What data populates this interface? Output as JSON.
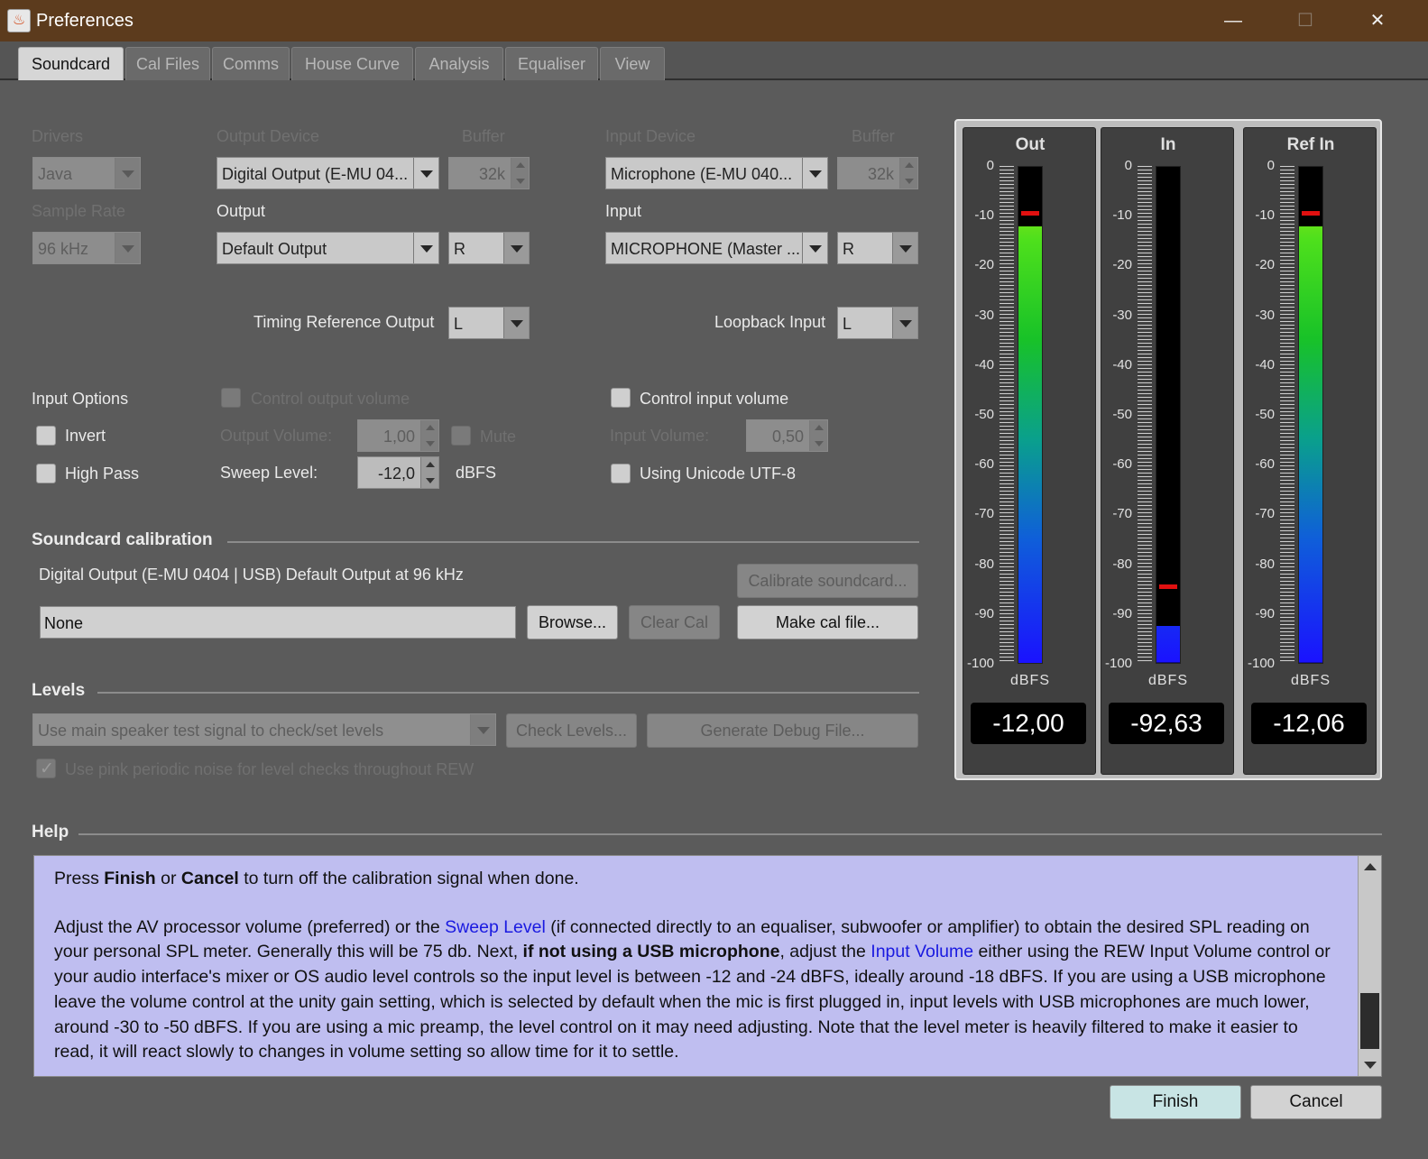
{
  "window": {
    "title": "Preferences"
  },
  "tabs": [
    "Soundcard",
    "Cal Files",
    "Comms",
    "House Curve",
    "Analysis",
    "Equaliser",
    "View"
  ],
  "drivers": {
    "label": "Drivers",
    "value": "Java"
  },
  "sample_rate": {
    "label": "Sample Rate",
    "value": "96 kHz"
  },
  "output_device": {
    "label": "Output Device",
    "value": "Digital Output (E-MU 04...",
    "buffer_label": "Buffer",
    "buffer": "32k"
  },
  "input_device": {
    "label": "Input Device",
    "value": "Microphone (E-MU 040...",
    "buffer_label": "Buffer",
    "buffer": "32k"
  },
  "output": {
    "label": "Output",
    "value": "Default Output",
    "channel": "R"
  },
  "input": {
    "label": "Input",
    "value": "MICROPHONE (Master ...",
    "channel": "R"
  },
  "timing_reference_output": {
    "label": "Timing Reference Output",
    "value": "L"
  },
  "loopback_input": {
    "label": "Loopback Input",
    "value": "L"
  },
  "input_options": {
    "label": "Input Options",
    "invert": "Invert",
    "high_pass": "High Pass"
  },
  "output_volume": {
    "control_label": "Control output volume",
    "label": "Output Volume:",
    "value": "1,00",
    "mute": "Mute"
  },
  "sweep": {
    "label": "Sweep Level:",
    "value": "-12,0",
    "unit": "dBFS"
  },
  "input_volume": {
    "control_label": "Control input volume",
    "label": "Input Volume:",
    "value": "0,50",
    "unicode": "Using Unicode UTF-8"
  },
  "calibration": {
    "title": "Soundcard calibration",
    "description": "Digital Output (E-MU 0404 | USB) Default Output at 96 kHz",
    "file": "None",
    "browse": "Browse...",
    "clear": "Clear Cal",
    "calibrate": "Calibrate soundcard...",
    "make": "Make cal file..."
  },
  "levels": {
    "title": "Levels",
    "signal": "Use main speaker test signal to check/set levels",
    "check": "Check Levels...",
    "debug": "Generate Debug File...",
    "pink": "Use pink periodic noise for level checks throughout REW"
  },
  "meters": {
    "ticks": [
      "0",
      "-10",
      "-20",
      "-30",
      "-40",
      "-50",
      "-60",
      "-70",
      "-80",
      "-90",
      "-100"
    ],
    "unit": "dBFS",
    "items": [
      {
        "name": "Out",
        "level": -12.0,
        "peak": -9.5,
        "readout": "-12,00"
      },
      {
        "name": "In",
        "level": -92.63,
        "peak": -84.5,
        "readout": "-92,63"
      },
      {
        "name": "Ref In",
        "level": -12.06,
        "peak": -9.5,
        "readout": "-12,06"
      }
    ]
  },
  "help": {
    "title": "Help",
    "p1_a": "Press ",
    "p1_b": "Finish",
    "p1_c": " or ",
    "p1_d": "Cancel",
    "p1_e": " to turn off the calibration signal when done.",
    "p2_a": "Adjust the AV processor volume (preferred) or the ",
    "p2_link1": "Sweep Level",
    "p2_b": " (if connected directly to an equaliser, subwoofer or amplifier) to obtain the desired SPL reading on your personal SPL meter. Generally this will be 75 db. Next, ",
    "p2_bold": "if not using a USB microphone",
    "p2_c": ", adjust the ",
    "p2_link2": "Input Volume",
    "p2_d": " either using the REW Input Volume control or your audio interface's mixer or OS audio level controls so the input level is between -12 and -24 dBFS, ideally around -18 dBFS. If you are using a USB microphone leave the volume control at the unity gain setting, which is selected by default when the mic is first plugged in, input levels with USB microphones are much lower, around -30 to -50 dBFS. If you are using a mic preamp, the level control on it may need adjusting. Note that the level meter is heavily filtered to make it easier to read, it will react slowly to changes in volume setting so allow time for it to settle."
  },
  "buttons": {
    "finish": "Finish",
    "cancel": "Cancel"
  }
}
